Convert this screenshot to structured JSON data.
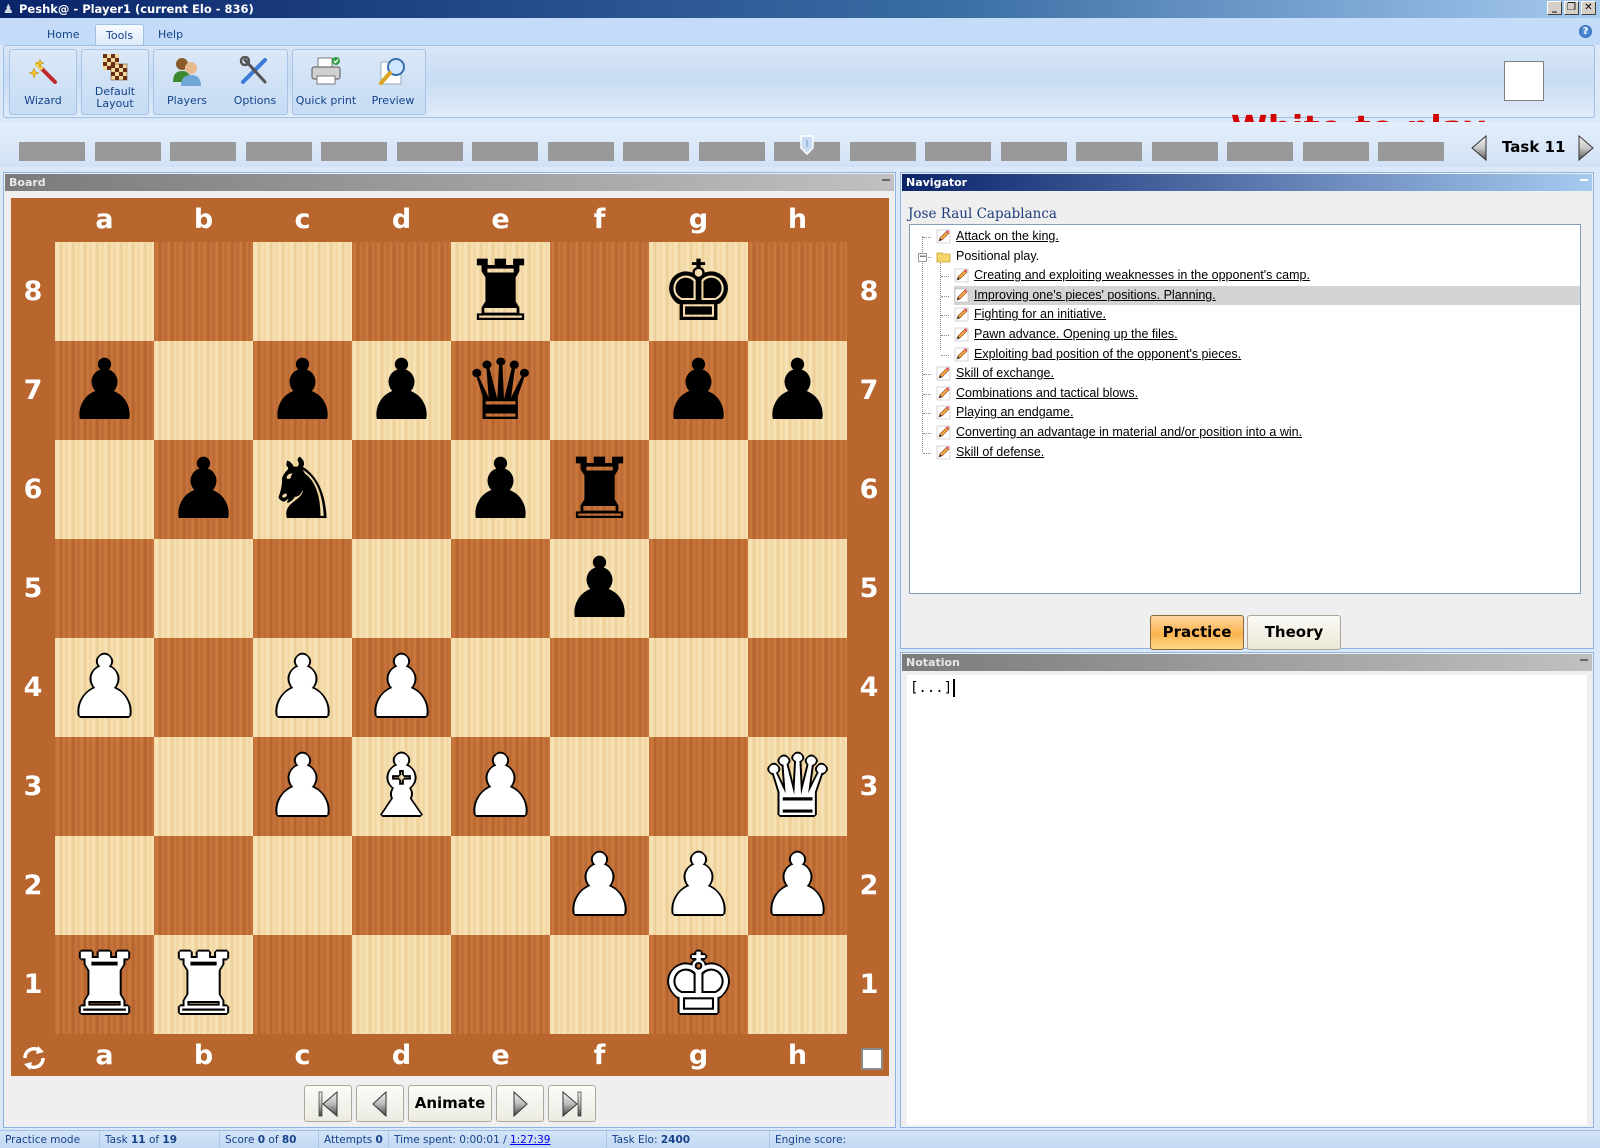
{
  "window": {
    "title": "Peshk@ -  Player1 (current Elo - 836)",
    "controls": {
      "minimize": "_",
      "restore": "❐",
      "close": "✕"
    }
  },
  "ribbon": {
    "tabs": [
      {
        "label": "Home",
        "active": false
      },
      {
        "label": "Tools",
        "active": true
      },
      {
        "label": "Help",
        "active": false
      }
    ],
    "help_icon": "?",
    "buttons": [
      {
        "label": "Wizard",
        "icon": "magic-wand-icon"
      },
      {
        "label_line1": "Default",
        "label_line2": "Layout",
        "icon": "chessboard-icon"
      },
      {
        "label": "Players",
        "icon": "players-icon"
      },
      {
        "label": "Options",
        "icon": "tools-icon"
      },
      {
        "label": "Quick print",
        "icon": "printer-icon"
      },
      {
        "label": "Preview",
        "icon": "magnifier-icon"
      }
    ],
    "turn_text": "White to play",
    "turn_color": "#d40000"
  },
  "task_strip": {
    "total_tasks": 19,
    "current_task": 11,
    "label": "Task 11"
  },
  "board": {
    "panel_title": "Board",
    "files": [
      "a",
      "b",
      "c",
      "d",
      "e",
      "f",
      "g",
      "h"
    ],
    "ranks": [
      "8",
      "7",
      "6",
      "5",
      "4",
      "3",
      "2",
      "1"
    ],
    "fen": "4r1k1/p1ppq1pp/1pn1pr2/5p2/P1PP4/2PBP2Q/5PPP/RR4K1",
    "pieces": [
      {
        "square": "e8",
        "piece": "♜",
        "color": "b",
        "name": "black-rook"
      },
      {
        "square": "g8",
        "piece": "♚",
        "color": "b",
        "name": "black-king"
      },
      {
        "square": "a7",
        "piece": "♟",
        "color": "b",
        "name": "black-pawn"
      },
      {
        "square": "c7",
        "piece": "♟",
        "color": "b",
        "name": "black-pawn"
      },
      {
        "square": "d7",
        "piece": "♟",
        "color": "b",
        "name": "black-pawn"
      },
      {
        "square": "e7",
        "piece": "♛",
        "color": "b",
        "name": "black-queen"
      },
      {
        "square": "g7",
        "piece": "♟",
        "color": "b",
        "name": "black-pawn"
      },
      {
        "square": "h7",
        "piece": "♟",
        "color": "b",
        "name": "black-pawn"
      },
      {
        "square": "b6",
        "piece": "♟",
        "color": "b",
        "name": "black-pawn"
      },
      {
        "square": "c6",
        "piece": "♞",
        "color": "b",
        "name": "black-knight"
      },
      {
        "square": "e6",
        "piece": "♟",
        "color": "b",
        "name": "black-pawn"
      },
      {
        "square": "f6",
        "piece": "♜",
        "color": "b",
        "name": "black-rook"
      },
      {
        "square": "f5",
        "piece": "♟",
        "color": "b",
        "name": "black-pawn"
      },
      {
        "square": "a4",
        "piece": "♟",
        "color": "w",
        "name": "white-pawn"
      },
      {
        "square": "c4",
        "piece": "♟",
        "color": "w",
        "name": "white-pawn"
      },
      {
        "square": "d4",
        "piece": "♟",
        "color": "w",
        "name": "white-pawn"
      },
      {
        "square": "c3",
        "piece": "♟",
        "color": "w",
        "name": "white-pawn"
      },
      {
        "square": "d3",
        "piece": "♝",
        "color": "w",
        "name": "white-bishop"
      },
      {
        "square": "e3",
        "piece": "♟",
        "color": "w",
        "name": "white-pawn"
      },
      {
        "square": "h3",
        "piece": "♛",
        "color": "w",
        "name": "white-queen"
      },
      {
        "square": "f2",
        "piece": "♟",
        "color": "w",
        "name": "white-pawn"
      },
      {
        "square": "g2",
        "piece": "♟",
        "color": "w",
        "name": "white-pawn"
      },
      {
        "square": "h2",
        "piece": "♟",
        "color": "w",
        "name": "white-pawn"
      },
      {
        "square": "a1",
        "piece": "♜",
        "color": "w",
        "name": "white-rook"
      },
      {
        "square": "b1",
        "piece": "♜",
        "color": "w",
        "name": "white-rook"
      },
      {
        "square": "g1",
        "piece": "♚",
        "color": "w",
        "name": "white-king"
      }
    ],
    "controls": {
      "first": "first-move",
      "prev": "previous-move",
      "animate_label": "Animate",
      "next": "next-move",
      "last": "last-move"
    }
  },
  "navigator": {
    "panel_title": "Navigator",
    "author": "Jose Raul Capablanca",
    "tree": [
      {
        "label": "Attack on the king.",
        "level": 0,
        "type": "task",
        "selected": false
      },
      {
        "label": "Positional play.",
        "level": 0,
        "type": "folder",
        "expanded": true,
        "selected": false
      },
      {
        "label": "Creating and exploiting weaknesses in the opponent's camp.",
        "level": 1,
        "type": "task",
        "selected": false
      },
      {
        "label": "Improving one's pieces' positions. Planning.",
        "level": 1,
        "type": "task",
        "selected": true
      },
      {
        "label": "Fighting for an initiative.",
        "level": 1,
        "type": "task",
        "selected": false
      },
      {
        "label": "Pawn advance. Opening up the files.",
        "level": 1,
        "type": "task",
        "selected": false
      },
      {
        "label": "Exploiting bad position of the opponent's pieces.",
        "level": 1,
        "type": "task",
        "selected": false
      },
      {
        "label": "Skill of exchange.",
        "level": 0,
        "type": "task",
        "selected": false
      },
      {
        "label": "Combinations and tactical blows.",
        "level": 0,
        "type": "task",
        "selected": false
      },
      {
        "label": "Playing an endgame.",
        "level": 0,
        "type": "task",
        "selected": false
      },
      {
        "label": "Converting an advantage in material and/or position into a win.",
        "level": 0,
        "type": "task",
        "selected": false
      },
      {
        "label": "Skill of defense.",
        "level": 0,
        "type": "task",
        "selected": false
      }
    ],
    "mode_buttons": {
      "practice": "Practice",
      "theory": "Theory",
      "active": "practice"
    }
  },
  "notation": {
    "panel_title": "Notation",
    "text": "[...]"
  },
  "statusbar": {
    "mode": "Practice mode",
    "task_prefix": "Task ",
    "task_current": "11",
    "task_of": " of ",
    "task_total": "19",
    "score_prefix": "Score ",
    "score_value": "0",
    "score_of": " of ",
    "score_total": "80",
    "attempts_prefix": "Attempts ",
    "attempts_value": "0",
    "time_prefix": "Time spent: 0:00:01 / ",
    "time_total": "1:27:39",
    "elo_prefix": "Task Elo: ",
    "elo_value": "2400",
    "engine_label": "Engine score:"
  }
}
